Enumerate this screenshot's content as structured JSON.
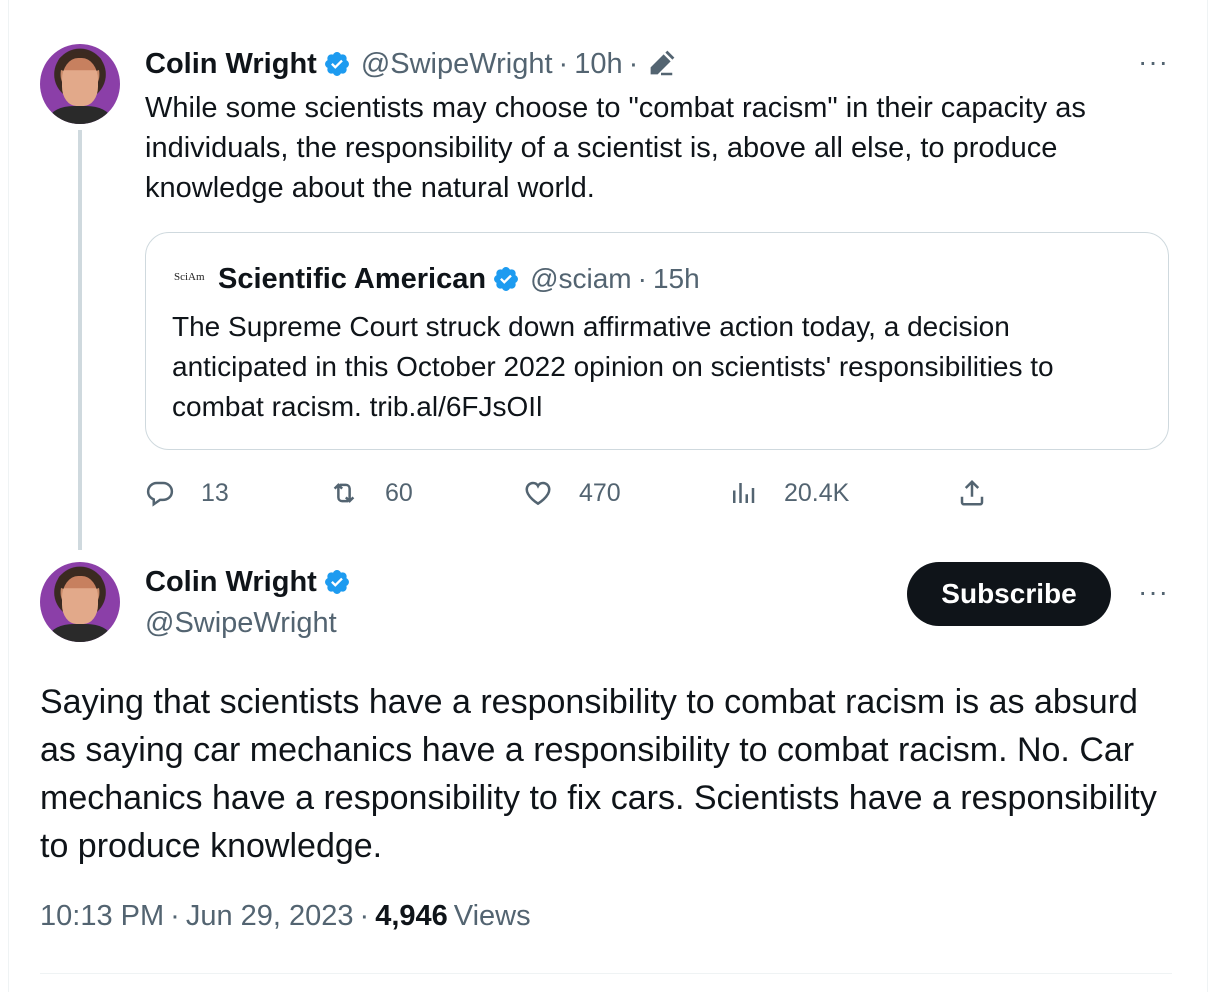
{
  "parent_tweet": {
    "author_name": "Colin Wright",
    "handle": "@SwipeWright",
    "separator": "·",
    "time": "10h",
    "edited_icon": "pencil-icon",
    "more_label": "···",
    "text": "While some scientists may choose to \"combat racism\" in their capacity as individuals, the responsibility of a scientist is, above all else, to produce knowledge about the natural world.",
    "quote": {
      "logo_text": "SciAm",
      "author_name": "Scientific American",
      "handle": "@sciam",
      "time": "15h",
      "text": "The Supreme Court struck down affirmative action today, a decision anticipated in this October 2022 opinion on scientists' responsibilities to combat racism. trib.al/6FJsOIl"
    },
    "actions": {
      "replies": "13",
      "reposts": "60",
      "likes": "470",
      "views": "20.4K"
    }
  },
  "main_tweet": {
    "author_name": "Colin Wright",
    "handle": "@SwipeWright",
    "subscribe_label": "Subscribe",
    "more_label": "···",
    "text": "Saying that scientists have a responsibility to combat racism is as absurd as saying car mechanics have a responsibility to combat racism. No. Car mechanics have a responsibility to fix cars. Scientists have a responsibility to produce knowledge.",
    "time": "10:13 PM",
    "date": "Jun 29, 2023",
    "views_count": "4,946",
    "views_label": "Views"
  },
  "colors": {
    "accent": "#1d9bf0",
    "text": "#0f1419",
    "secondary": "#536471",
    "border": "#cfd9de"
  }
}
